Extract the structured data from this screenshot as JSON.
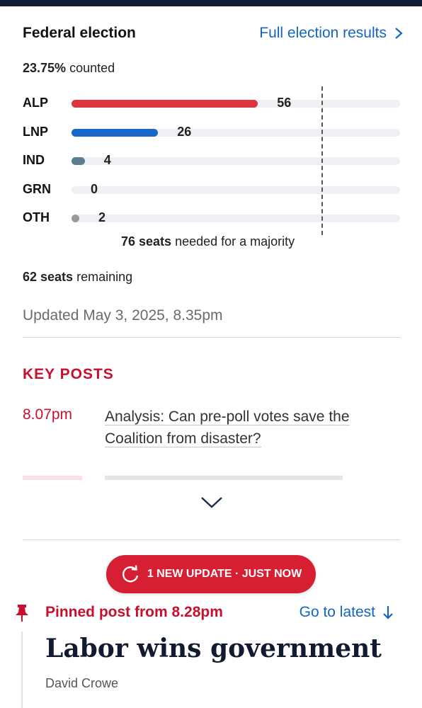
{
  "header": {
    "title": "Federal election",
    "full_results_link": "Full election results"
  },
  "count": {
    "percent": "23.75%",
    "suffix": "counted"
  },
  "parties": [
    {
      "code": "ALP",
      "seats": 56,
      "color": "#e03340"
    },
    {
      "code": "LNP",
      "seats": 26,
      "color": "#1766c9"
    },
    {
      "code": "IND",
      "seats": 4,
      "color": "#5a7d90"
    },
    {
      "code": "GRN",
      "seats": 0,
      "color": "#2f8f3e"
    },
    {
      "code": "OTH",
      "seats": 2,
      "color": "#9a9a9a"
    }
  ],
  "majority": {
    "seats": "76 seats",
    "text": "needed for a majority"
  },
  "remaining": {
    "seats": "62 seats",
    "text": "remaining"
  },
  "updated": "Updated May 3, 2025, 8.35pm",
  "key_posts": {
    "heading": "KEY POSTS",
    "items": [
      {
        "time": "8.07pm",
        "headline": "Analysis: Can pre-poll votes save the Coalition from disaster?"
      }
    ]
  },
  "new_update_button": "1 NEW UPDATE · JUST NOW",
  "pinned": {
    "label": "Pinned post from 8.28pm",
    "go_latest": "Go to latest",
    "title": "Labor wins government",
    "author": "David Crowe"
  },
  "colors": {
    "accent_red": "#c8102e",
    "link_blue": "#1565c0",
    "pill_red": "#d71f33"
  }
}
